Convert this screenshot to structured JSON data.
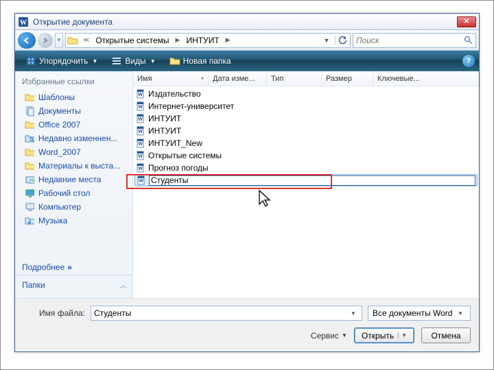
{
  "title": "Открытие документа",
  "nav": {
    "crumbs": [
      "Открытые системы",
      "ИНТУИТ"
    ],
    "search_placeholder": "Поиск"
  },
  "toolbar": {
    "organize": "Упорядочить",
    "views": "Виды",
    "new_folder": "Новая папка"
  },
  "sidebar": {
    "header": "Избранные ссылки",
    "items": [
      {
        "label": "Шаблоны",
        "icon": "folder"
      },
      {
        "label": "Документы",
        "icon": "documents"
      },
      {
        "label": "Office 2007",
        "icon": "folder"
      },
      {
        "label": "Недавно изменнен...",
        "icon": "search-folder"
      },
      {
        "label": "Word_2007",
        "icon": "folder"
      },
      {
        "label": "Материалы к выста...",
        "icon": "folder"
      },
      {
        "label": "Недавние места",
        "icon": "recent"
      },
      {
        "label": "Рабочий стол",
        "icon": "desktop"
      },
      {
        "label": "Компьютер",
        "icon": "computer"
      },
      {
        "label": "Музыка",
        "icon": "music"
      }
    ],
    "more": "Подробнее",
    "folders": "Папки"
  },
  "columns": [
    "Имя",
    "Дата изме...",
    "Тип",
    "Размер",
    "Ключевые..."
  ],
  "files": [
    "Издательство",
    "Интернет-университет",
    "ИНТУИТ",
    "ИНТУИТ",
    "ИНТУИТ_New",
    "Открытые системы",
    "Прогноз погоды"
  ],
  "selected_file": "Студенты",
  "footer": {
    "filename_label": "Имя файла:",
    "filename_value": "Студенты",
    "filter": "Все документы Word",
    "services": "Сервис",
    "open": "Открыть",
    "cancel": "Отмена"
  }
}
